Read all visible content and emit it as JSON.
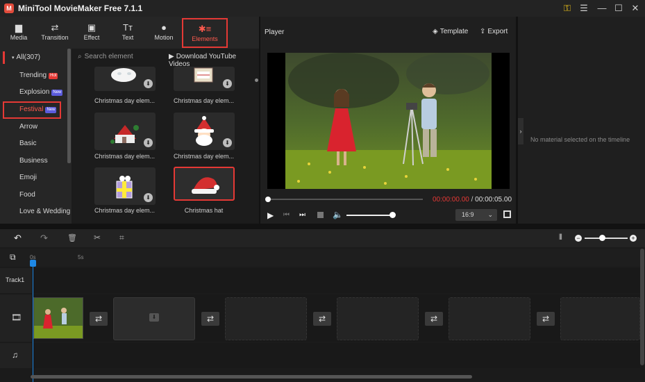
{
  "app": {
    "title": "MiniTool MovieMaker Free 7.1.1",
    "logo": "M"
  },
  "window": {
    "key_icon": "⚿",
    "menu_icon": "☰",
    "min_icon": "—",
    "max_icon": "☐",
    "close_icon": "✕"
  },
  "toolbar": [
    {
      "label": "Media",
      "icon": "▆"
    },
    {
      "label": "Transition",
      "icon": "⇄"
    },
    {
      "label": "Effect",
      "icon": "▣"
    },
    {
      "label": "Text",
      "icon": "Tт"
    },
    {
      "label": "Motion",
      "icon": "●"
    },
    {
      "label": "Elements",
      "icon": "✱≡"
    }
  ],
  "categories": {
    "all": "All(307)",
    "items": [
      {
        "label": "Trending",
        "badge": "Hot"
      },
      {
        "label": "Explosion",
        "badge": "New"
      },
      {
        "label": "Festival",
        "badge": "New"
      },
      {
        "label": "Arrow",
        "badge": ""
      },
      {
        "label": "Basic",
        "badge": ""
      },
      {
        "label": "Business",
        "badge": ""
      },
      {
        "label": "Emoji",
        "badge": ""
      },
      {
        "label": "Food",
        "badge": ""
      },
      {
        "label": "Love & Wedding",
        "badge": ""
      }
    ]
  },
  "search": {
    "placeholder": "Search element",
    "youtube_label": "Download YouTube Videos"
  },
  "elements": [
    {
      "caption": "Christmas day elem..."
    },
    {
      "caption": "Christmas day elem..."
    },
    {
      "caption": "Christmas day elem..."
    },
    {
      "caption": "Christmas day elem..."
    },
    {
      "caption": "Christmas day elem..."
    },
    {
      "caption": "Christmas hat"
    }
  ],
  "player": {
    "title": "Player",
    "template_label": "Template",
    "export_label": "Export",
    "time_current": "00:00:00.00",
    "time_separator": "/",
    "time_total": "00:00:05.00",
    "aspect_ratio": "16:9",
    "progress": 0,
    "volume": 1.0
  },
  "right_panel": {
    "empty_text": "No material selected on the timeline"
  },
  "timeline": {
    "ruler": [
      "0s",
      "5s"
    ],
    "track_label": "Track1",
    "zoom": 0.45
  },
  "colors": {
    "accent": "#e53935",
    "playhead": "#1e88e5"
  }
}
